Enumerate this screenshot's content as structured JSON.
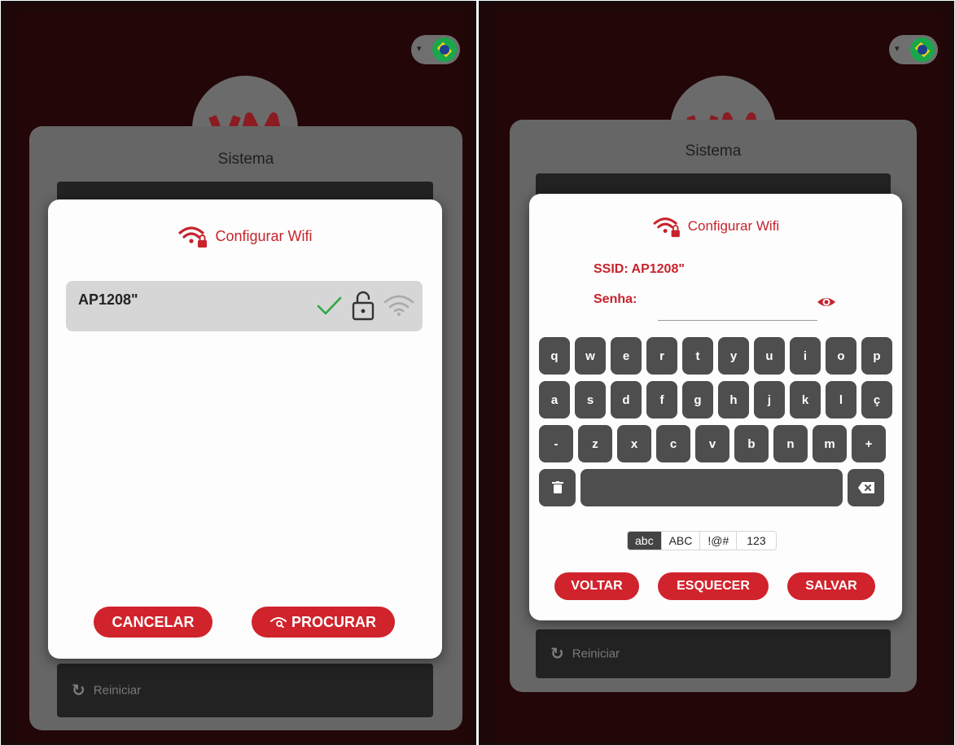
{
  "background": {
    "system_title": "Sistema",
    "reiniciar_label": "Reiniciar",
    "logo_text": "VM"
  },
  "scan_dialog": {
    "title": "Configurar Wifi",
    "networks": [
      {
        "ssid": "AP1208\"",
        "connected": true,
        "secured": true,
        "signal_icon": "wifi-icon"
      }
    ],
    "cancel_label": "CANCELAR",
    "search_label": "PROCURAR"
  },
  "password_dialog": {
    "title": "Configurar Wifi",
    "ssid_label": "SSID: AP1208\"",
    "password_label": "Senha:",
    "password_value": "",
    "keyboard": {
      "rows": [
        [
          "q",
          "w",
          "e",
          "r",
          "t",
          "y",
          "u",
          "i",
          "o",
          "p"
        ],
        [
          "a",
          "s",
          "d",
          "f",
          "g",
          "h",
          "j",
          "k",
          "l",
          "ç"
        ],
        [
          "-",
          "z",
          "x",
          "c",
          "v",
          "b",
          "n",
          "m",
          "+"
        ]
      ],
      "modes": [
        "abc",
        "ABC",
        "!@#",
        "123"
      ],
      "active_mode": "abc"
    },
    "back_label": "VOLTAR",
    "forget_label": "ESQUECER",
    "save_label": "SALVAR"
  },
  "colors": {
    "accent": "#c8232c",
    "check": "#2fa84a",
    "backdrop": "#230608"
  }
}
